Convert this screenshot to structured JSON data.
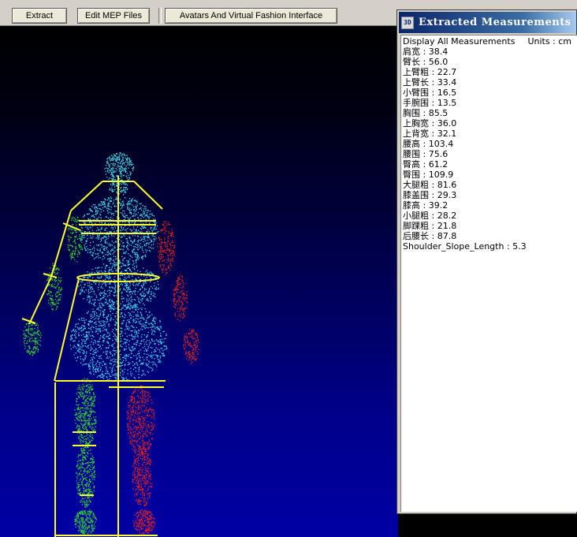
{
  "toolbar": {
    "extract_label": "Extract",
    "edit_mep_label": "Edit MEP Files",
    "avatars_label": "Avatars And Virtual Fashion Interface"
  },
  "viewport": {
    "description_icon": "body-scan-point-cloud",
    "colors": {
      "torso": "#40e0f0",
      "left_limb": "#2dd62d",
      "right_limb": "#e02020",
      "guide_lines": "#ffff30"
    }
  },
  "panel": {
    "icon_text": "3D",
    "title": "Extracted Measurements",
    "display_label": "Display All Measurements",
    "units_label": "Units : cm",
    "measurements": [
      "肩宽 : 38.4",
      "臂长 : 56.0",
      "上臂粗 : 22.7",
      "上臂长 : 33.4",
      "小臂围 : 16.5",
      "手腕围 : 13.5",
      "胸围 : 85.5",
      "上胸宽 : 36.0",
      "上背宽 : 32.1",
      "腰高 : 103.4",
      "腰围 : 75.6",
      "臀高 : 61.2",
      "臀围 : 109.9",
      "大腿粗 : 81.6",
      "膝盖围 : 29.3",
      "膝高 : 39.2",
      "小腿粗 : 28.2",
      "脚踝粗 : 21.8",
      "后腰长 : 87.8",
      "Shoulder_Slope_Length : 5.3"
    ]
  }
}
